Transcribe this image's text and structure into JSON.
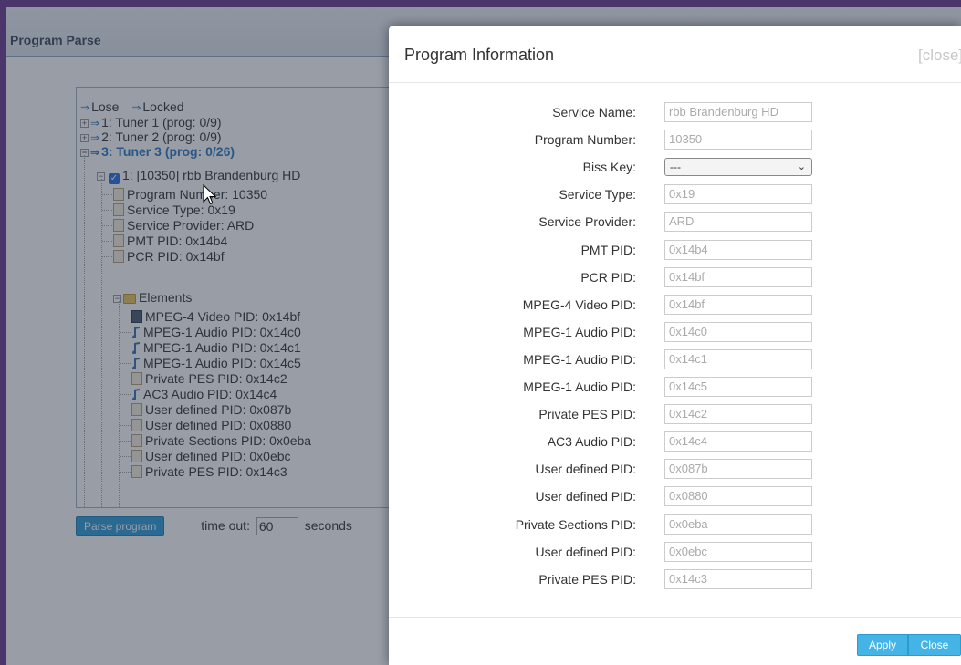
{
  "background": {
    "panel_title": "Program Parse",
    "legend": {
      "lose": "Lose",
      "locked": "Locked"
    },
    "tree": {
      "tuner1": "1: Tuner 1 (prog: 0/9)",
      "tuner2": "2: Tuner 2 (prog: 0/9)",
      "tuner3": "3: Tuner 3 (prog: 0/26)",
      "program": "1: [10350] rbb Brandenburg HD",
      "props": [
        "Program Number: 10350",
        "Service Type: 0x19",
        "Service Provider: ARD",
        "PMT PID: 0x14b4",
        "PCR PID: 0x14bf"
      ],
      "elements_label": "Elements",
      "elements": [
        {
          "icon": "video-icon",
          "text": "MPEG-4 Video PID: 0x14bf"
        },
        {
          "icon": "audio-icon",
          "text": "MPEG-1 Audio PID: 0x14c0"
        },
        {
          "icon": "audio-icon",
          "text": "MPEG-1 Audio PID: 0x14c1"
        },
        {
          "icon": "audio-icon",
          "text": "MPEG-1 Audio PID: 0x14c5"
        },
        {
          "icon": "file-icon",
          "text": "Private PES PID: 0x14c2"
        },
        {
          "icon": "audio-icon",
          "text": "AC3 Audio PID: 0x14c4"
        },
        {
          "icon": "file-icon",
          "text": "User defined PID: 0x087b"
        },
        {
          "icon": "file-icon",
          "text": "User defined PID: 0x0880"
        },
        {
          "icon": "file-icon",
          "text": "Private Sections PID: 0x0eba"
        },
        {
          "icon": "file-icon",
          "text": "User defined PID: 0x0ebc"
        },
        {
          "icon": "file-icon",
          "text": "Private PES PID: 0x14c3"
        }
      ]
    },
    "parse_button": "Parse program",
    "timeout_label": "time out:",
    "timeout_value": "60",
    "timeout_unit": "seconds"
  },
  "modal": {
    "title": "Program Information",
    "close_link": "[close]",
    "fields": [
      {
        "label": "Service Name:",
        "value": "rbb Brandenburg HD"
      },
      {
        "label": "Program Number:",
        "value": "10350"
      },
      {
        "label": "Biss Key:",
        "value": "---",
        "type": "select"
      },
      {
        "label": "Service Type:",
        "value": "0x19"
      },
      {
        "label": "Service Provider:",
        "value": "ARD"
      },
      {
        "label": "PMT PID:",
        "value": "0x14b4"
      },
      {
        "label": "PCR PID:",
        "value": "0x14bf"
      },
      {
        "label": "MPEG-4 Video PID:",
        "value": "0x14bf"
      },
      {
        "label": "MPEG-1 Audio PID:",
        "value": "0x14c0"
      },
      {
        "label": "MPEG-1 Audio PID:",
        "value": "0x14c1"
      },
      {
        "label": "MPEG-1 Audio PID:",
        "value": "0x14c5"
      },
      {
        "label": "Private PES PID:",
        "value": "0x14c2"
      },
      {
        "label": "AC3 Audio PID:",
        "value": "0x14c4"
      },
      {
        "label": "User defined PID:",
        "value": "0x087b"
      },
      {
        "label": "User defined PID:",
        "value": "0x0880"
      },
      {
        "label": "Private Sections PID:",
        "value": "0x0eba"
      },
      {
        "label": "User defined PID:",
        "value": "0x0ebc"
      },
      {
        "label": "Private PES PID:",
        "value": "0x14c3"
      }
    ],
    "apply_button": "Apply",
    "close_button": "Close"
  }
}
